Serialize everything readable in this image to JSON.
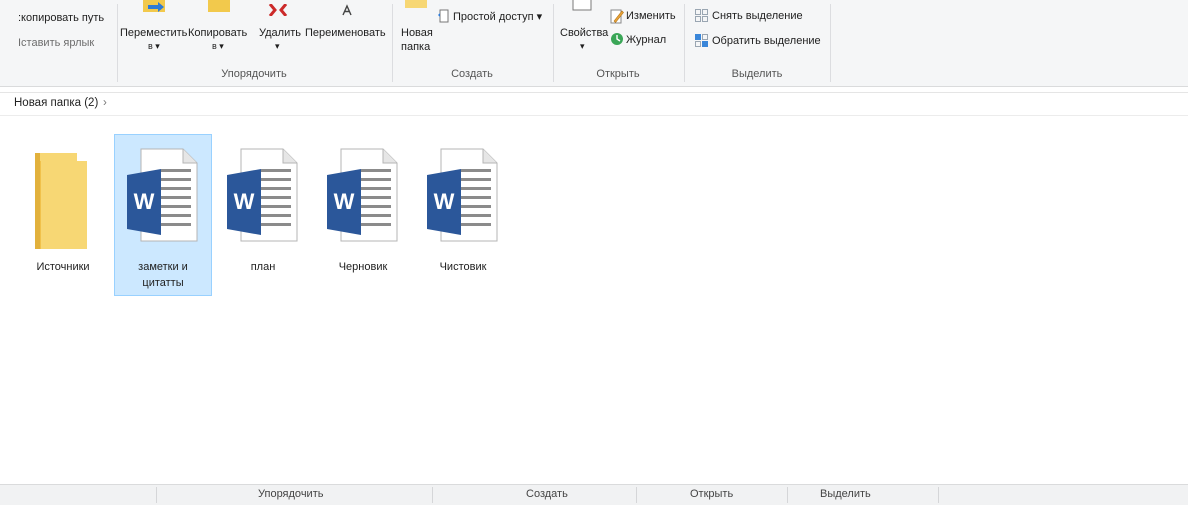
{
  "ribbon": {
    "clipboard": {
      "copy_path": ":копировать путь",
      "paste_shortcut": "Iставить ярлык"
    },
    "organize": {
      "label": "Упорядочить",
      "move_to": "Переместить",
      "move_to_sub": "в ▾",
      "copy_to": "Копировать",
      "copy_to_sub": "в ▾",
      "delete": "Удалить",
      "delete_sub": "▾",
      "rename": "Переименовать"
    },
    "create": {
      "label": "Создать",
      "new_folder_1": "Новая",
      "new_folder_2": "папка",
      "easy_access": "Простой доступ ▾"
    },
    "open": {
      "label": "Открыть",
      "properties": "Свойства",
      "properties_sub": "▾",
      "edit": "Изменить",
      "history": "Журнал"
    },
    "select": {
      "label": "Выделить",
      "select_none": "Снять выделение",
      "invert_selection": "Обратить выделение"
    }
  },
  "breadcrumb": {
    "folder": "Новая папка (2)",
    "chevron": "›"
  },
  "items": [
    {
      "icon": "folder-icon",
      "name": "Источники",
      "selected": false
    },
    {
      "icon": "word-document-icon",
      "name_line1": "заметки и",
      "name_line2": "цитатты",
      "selected": true
    },
    {
      "icon": "word-document-icon",
      "name": "план",
      "selected": false
    },
    {
      "icon": "word-document-icon",
      "name": "Черновик",
      "selected": false
    },
    {
      "icon": "word-document-icon",
      "name": "Чистовик",
      "selected": false
    }
  ],
  "bottom_bar": {
    "organize": "Упорядочить",
    "create": "Создать",
    "open": "Открыть",
    "select": "Выделить"
  },
  "colors": {
    "selection_bg": "#cce8ff",
    "selection_border": "#99d1ff",
    "word_blue": "#2b579a",
    "folder_yellow": "#f7d774"
  }
}
